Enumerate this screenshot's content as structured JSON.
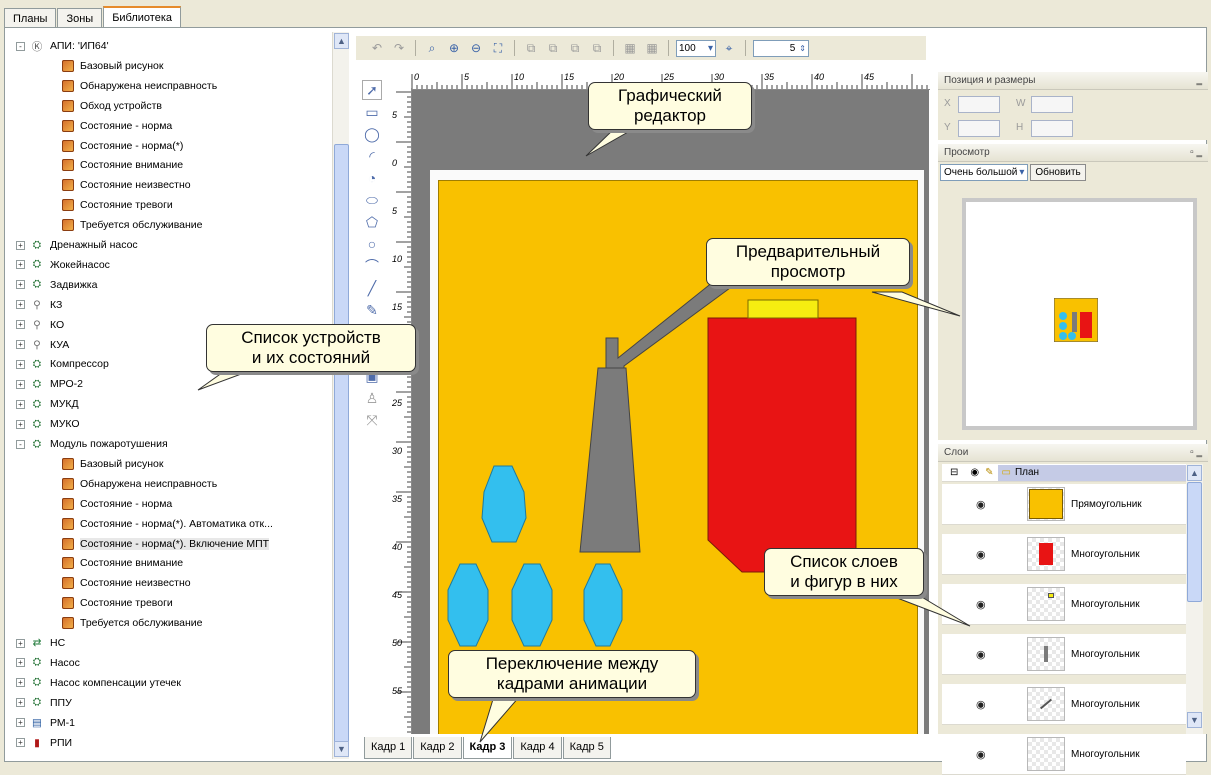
{
  "top_tabs": [
    "Планы",
    "Зоны",
    "Библиотека"
  ],
  "tree": {
    "items": [
      {
        "label": "АПИ: 'ИП64'",
        "level": 0,
        "icon": "api-circle-icon",
        "expander": "-"
      },
      {
        "label": "Базовый рисунок",
        "level": 1,
        "icon": "state-icon"
      },
      {
        "label": "Обнаружена неисправность",
        "level": 1,
        "icon": "state-icon"
      },
      {
        "label": "Обход устройств",
        "level": 1,
        "icon": "state-icon"
      },
      {
        "label": "Состояние - норма",
        "level": 1,
        "icon": "state-icon"
      },
      {
        "label": "Состояние - норма(*)",
        "level": 1,
        "icon": "state-icon"
      },
      {
        "label": "Состояние внимание",
        "level": 1,
        "icon": "state-icon"
      },
      {
        "label": "Состояние неизвестно",
        "level": 1,
        "icon": "state-icon"
      },
      {
        "label": "Состояние тревоги",
        "level": 1,
        "icon": "state-icon"
      },
      {
        "label": "Требуется обслуживание",
        "level": 1,
        "icon": "state-icon"
      },
      {
        "label": "Дренажный насос",
        "level": 0,
        "icon": "pump-icon",
        "expander": "+"
      },
      {
        "label": "Жокейнасос",
        "level": 0,
        "icon": "pump-icon",
        "expander": "+"
      },
      {
        "label": "Задвижка",
        "level": 0,
        "icon": "pump-icon",
        "expander": "+"
      },
      {
        "label": "КЗ",
        "level": 0,
        "icon": "valve-icon",
        "expander": "+"
      },
      {
        "label": "КО",
        "level": 0,
        "icon": "valve-icon",
        "expander": "+"
      },
      {
        "label": "КУА",
        "level": 0,
        "icon": "valve-icon",
        "expander": "+"
      },
      {
        "label": "Компрессор",
        "level": 0,
        "icon": "pump-icon",
        "expander": "+"
      },
      {
        "label": "МРО-2",
        "level": 0,
        "icon": "pump-icon",
        "expander": "+"
      },
      {
        "label": "МУКД",
        "level": 0,
        "icon": "pump-icon",
        "expander": "+"
      },
      {
        "label": "МУКО",
        "level": 0,
        "icon": "pump-icon",
        "expander": "+"
      },
      {
        "label": "Модуль пожаротушения",
        "level": 0,
        "icon": "pump-icon",
        "expander": "-"
      },
      {
        "label": "Базовый рисунок",
        "level": 1,
        "icon": "state-icon"
      },
      {
        "label": "Обнаружена неисправность",
        "level": 1,
        "icon": "state-icon"
      },
      {
        "label": "Состояние - норма",
        "level": 1,
        "icon": "state-icon"
      },
      {
        "label": "Состояние - норма(*). Автоматика отк...",
        "level": 1,
        "icon": "state-icon"
      },
      {
        "label": "Состояние - норма(*). Включение МПТ",
        "level": 1,
        "icon": "state-icon",
        "selected": true
      },
      {
        "label": "Состояние внимание",
        "level": 1,
        "icon": "state-icon"
      },
      {
        "label": "Состояние неизвестно",
        "level": 1,
        "icon": "state-icon"
      },
      {
        "label": "Состояние тревоги",
        "level": 1,
        "icon": "state-icon"
      },
      {
        "label": "Требуется обслуживание",
        "level": 1,
        "icon": "state-icon"
      },
      {
        "label": "НС",
        "level": 0,
        "icon": "network-icon",
        "expander": "+"
      },
      {
        "label": "Насос",
        "level": 0,
        "icon": "pump-icon",
        "expander": "+"
      },
      {
        "label": "Насос компенсации утечек",
        "level": 0,
        "icon": "pump-icon",
        "expander": "+"
      },
      {
        "label": "ППУ",
        "level": 0,
        "icon": "pump-icon",
        "expander": "+"
      },
      {
        "label": "РМ-1",
        "level": 0,
        "icon": "device-icon",
        "expander": "+"
      },
      {
        "label": "РПИ",
        "level": 0,
        "icon": "extinguisher-icon",
        "expander": "+"
      }
    ]
  },
  "toolbar": {
    "zoom_value": "100",
    "spin_value": "5"
  },
  "ruler_top_labels": [
    "0",
    "5",
    "10",
    "15",
    "20",
    "25",
    "30",
    "35",
    "40",
    "45"
  ],
  "ruler_left_labels": [
    "5",
    "0",
    "5",
    "10",
    "15",
    "20",
    "25",
    "30",
    "35",
    "40",
    "45",
    "50",
    "55"
  ],
  "callouts": {
    "editor": "Графический\nредактор",
    "devices": "Список устройств\nи их состояний",
    "preview": "Предварительный\nпросмотр",
    "layers": "Список слоев\nи фигур в них",
    "frames": "Переключение между\nкадрами анимации"
  },
  "frame_tabs": [
    "Кадр 1",
    "Кадр 2",
    "Кадр 3",
    "Кадр 4",
    "Кадр 5"
  ],
  "active_frame_index": 2,
  "right": {
    "position_title": "Позиция и размеры",
    "fields": {
      "x": "X",
      "w": "W",
      "y": "Y",
      "h": "H"
    },
    "preview_title": "Просмотр",
    "preview_size": "Очень большой",
    "refresh": "Обновить",
    "layers_title": "Слои",
    "layer_group": "План",
    "layers": [
      {
        "name": "Прямоугольник",
        "thumb": "yellow-rect"
      },
      {
        "name": "Многоугольник",
        "thumb": "red-cylinder"
      },
      {
        "name": "Многоугольник",
        "thumb": "small-top"
      },
      {
        "name": "Многоугольник",
        "thumb": "nozzle"
      },
      {
        "name": "Многоугольник",
        "thumb": "pipe"
      },
      {
        "name": "Многоугольник",
        "thumb": "empty"
      }
    ]
  },
  "colors": {
    "background_yellow": "#f9c100",
    "cylinder_red": "#e81414",
    "drops_blue": "#33bfee",
    "grey": "#7b7b7b"
  }
}
